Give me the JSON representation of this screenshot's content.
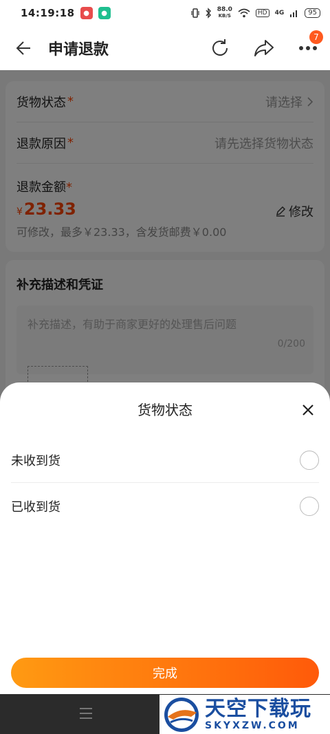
{
  "status_bar": {
    "time": "14:19:18",
    "net_speed": "88.0",
    "net_unit": "KB/S",
    "hd": "HD",
    "network": "4G",
    "battery": "95"
  },
  "header": {
    "title": "申请退款",
    "badge_count": "7"
  },
  "form": {
    "goods_status_label": "货物状态",
    "goods_status_value": "请选择",
    "refund_reason_label": "退款原因",
    "refund_reason_value": "请先选择货物状态",
    "amount_label": "退款金额",
    "currency": "¥",
    "amount": "23.33",
    "modify_label": "修改",
    "amount_note": "可修改，最多￥23.33，含发货邮费￥0.00",
    "required_mark": "*"
  },
  "supplement": {
    "heading": "补充描述和凭证",
    "placeholder": "补充描述，有助于商家更好的处理售后问题",
    "counter": "0/200"
  },
  "sheet": {
    "title": "货物状态",
    "options": [
      "未收到货",
      "已收到货"
    ],
    "done_label": "完成"
  },
  "watermark": {
    "big": "天空下载玩",
    "small": "SKYXZW.COM"
  },
  "colors": {
    "accent": "#ff5a0a",
    "accent_start": "#ff9a12",
    "required": "#ff4400"
  }
}
